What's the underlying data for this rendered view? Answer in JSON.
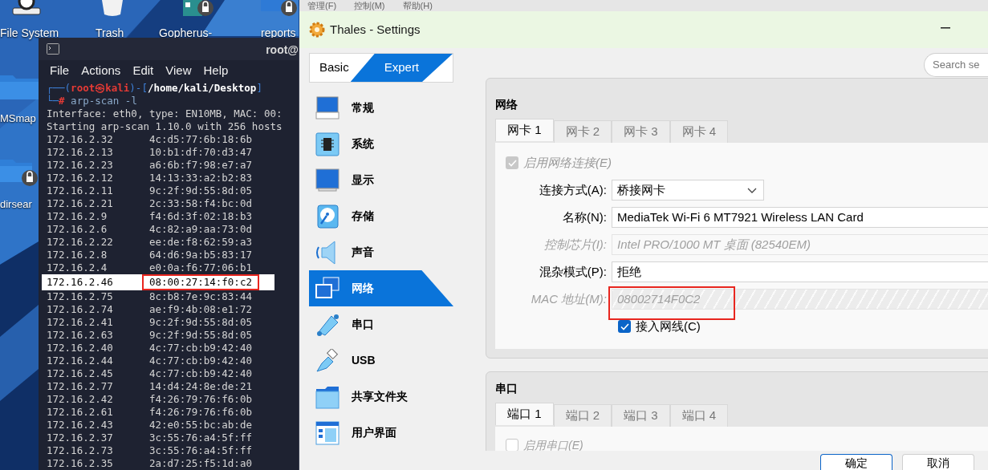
{
  "manager_menu": [
    "管理(F)",
    "控制(M)",
    "帮助(H)"
  ],
  "desktop_icons": [
    {
      "label": "File System"
    },
    {
      "label": "Trash"
    },
    {
      "label": "Gopherus-"
    },
    {
      "label": "reports"
    },
    {
      "label": "MSmap"
    },
    {
      "label": "dirsear"
    }
  ],
  "terminal": {
    "title": "root@",
    "menu": [
      "File",
      "Actions",
      "Edit",
      "View",
      "Help"
    ],
    "prompt": [
      [
        {
          "kind": "frame",
          "text": "┌──("
        },
        {
          "kind": "user",
          "text": "root㉿kali"
        },
        {
          "kind": "frame",
          "text": ")-["
        },
        {
          "kind": "path",
          "text": "/home/kali/Desktop"
        },
        {
          "kind": "frame",
          "text": "]"
        }
      ],
      [
        {
          "kind": "frame",
          "text": "└─"
        },
        {
          "kind": "user",
          "text": "#"
        },
        {
          "kind": "command",
          "text": " arp-scan -l"
        }
      ]
    ],
    "output": [
      "Interface: eth0, type: EN10MB, MAC: 00:",
      "Starting arp-scan 1.10.0 with 256 hosts"
    ],
    "rows": [
      {
        "ip": "172.16.2.32",
        "mac": "4c:d5:77:6b:18:6b",
        "selected": false
      },
      {
        "ip": "172.16.2.13",
        "mac": "10:b1:df:70:d3:47",
        "selected": false
      },
      {
        "ip": "172.16.2.23",
        "mac": "a6:6b:f7:98:e7:a7",
        "selected": false
      },
      {
        "ip": "172.16.2.12",
        "mac": "14:13:33:a2:b2:83",
        "selected": false
      },
      {
        "ip": "172.16.2.11",
        "mac": "9c:2f:9d:55:8d:05",
        "selected": false
      },
      {
        "ip": "172.16.2.21",
        "mac": "2c:33:58:f4:bc:0d",
        "selected": false
      },
      {
        "ip": "172.16.2.9",
        "mac": "f4:6d:3f:02:18:b3",
        "selected": false
      },
      {
        "ip": "172.16.2.6",
        "mac": "4c:82:a9:aa:73:0d",
        "selected": false
      },
      {
        "ip": "172.16.2.22",
        "mac": "ee:de:f8:62:59:a3",
        "selected": false
      },
      {
        "ip": "172.16.2.8",
        "mac": "64:d6:9a:b5:83:17",
        "selected": false
      },
      {
        "ip": "172.16.2.4",
        "mac": "e0:0a:f6:77:06:b1",
        "selected": false
      },
      {
        "ip": "172.16.2.46",
        "mac": "08:00:27:14:f0:c2",
        "selected": true
      },
      {
        "ip": "172.16.2.75",
        "mac": "8c:b8:7e:9c:83:44",
        "selected": false
      },
      {
        "ip": "172.16.2.74",
        "mac": "ae:f9:4b:08:e1:72",
        "selected": false
      },
      {
        "ip": "172.16.2.41",
        "mac": "9c:2f:9d:55:8d:05",
        "selected": false
      },
      {
        "ip": "172.16.2.63",
        "mac": "9c:2f:9d:55:8d:05",
        "selected": false
      },
      {
        "ip": "172.16.2.40",
        "mac": "4c:77:cb:b9:42:40",
        "selected": false
      },
      {
        "ip": "172.16.2.44",
        "mac": "4c:77:cb:b9:42:40",
        "selected": false
      },
      {
        "ip": "172.16.2.45",
        "mac": "4c:77:cb:b9:42:40",
        "selected": false
      },
      {
        "ip": "172.16.2.77",
        "mac": "14:d4:24:8e:de:21",
        "selected": false
      },
      {
        "ip": "172.16.2.42",
        "mac": "f4:26:79:76:f6:0b",
        "selected": false
      },
      {
        "ip": "172.16.2.61",
        "mac": "f4:26:79:76:f6:0b",
        "selected": false
      },
      {
        "ip": "172.16.2.43",
        "mac": "42:e0:55:bc:ab:de",
        "selected": false
      },
      {
        "ip": "172.16.2.37",
        "mac": "3c:55:76:a4:5f:ff",
        "selected": false
      },
      {
        "ip": "172.16.2.73",
        "mac": "3c:55:76:a4:5f:ff",
        "selected": false
      },
      {
        "ip": "172.16.2.35",
        "mac": "2a:d7:25:f5:1d:a0",
        "selected": false
      }
    ]
  },
  "settings": {
    "title": "Thales - Settings",
    "modes": [
      {
        "label": "Basic",
        "selected": false
      },
      {
        "label": "Expert",
        "selected": true
      }
    ],
    "search": {
      "placeholder": "Search se"
    },
    "sidebar": [
      {
        "label": "常规",
        "selected": false
      },
      {
        "label": "系统",
        "selected": false
      },
      {
        "label": "显示",
        "selected": false
      },
      {
        "label": "存储",
        "selected": false
      },
      {
        "label": "声音",
        "selected": false
      },
      {
        "label": "网络",
        "selected": true
      },
      {
        "label": "串口",
        "selected": false
      },
      {
        "label": "USB",
        "selected": false
      },
      {
        "label": "共享文件夹",
        "selected": false
      },
      {
        "label": "用户界面",
        "selected": false
      }
    ],
    "network": {
      "heading": "网络",
      "tabs": [
        {
          "label": "网卡 1",
          "selected": true
        },
        {
          "label": "网卡 2",
          "selected": false
        },
        {
          "label": "网卡 3",
          "selected": false
        },
        {
          "label": "网卡 4",
          "selected": false
        }
      ],
      "enable": {
        "label": "启用网络连接(E)",
        "checked": true,
        "disabled": true
      },
      "fields": [
        {
          "kind": "dropdown",
          "label": "连接方式(A):",
          "value": "桥接网卡",
          "disabled": false
        },
        {
          "kind": "combo",
          "label": "名称(N):",
          "value": "MediaTek Wi-Fi 6 MT7921 Wireless LAN Card",
          "disabled": false
        },
        {
          "kind": "combo",
          "label": "控制芯片(I):",
          "value": "Intel PRO/1000 MT 桌面 (82540EM)",
          "disabled": true
        },
        {
          "kind": "combo",
          "label": "混杂模式(P):",
          "value": "拒绝",
          "disabled": false
        },
        {
          "kind": "text",
          "label": "MAC 地址(M):",
          "value": "08002714F0C2",
          "disabled": true
        }
      ],
      "cable": {
        "label": "接入网线(C)",
        "checked": true
      }
    },
    "serial": {
      "heading": "串口",
      "tabs": [
        {
          "label": "端口 1",
          "selected": true
        },
        {
          "label": "端口 2",
          "selected": false
        },
        {
          "label": "端口 3",
          "selected": false
        },
        {
          "label": "端口 4",
          "selected": false
        }
      ],
      "enable": {
        "label": "启用串口(E)",
        "checked": false,
        "disabled": true
      }
    },
    "buttons": [
      {
        "label": "确定",
        "default": true
      },
      {
        "label": "取消",
        "default": false
      }
    ]
  }
}
